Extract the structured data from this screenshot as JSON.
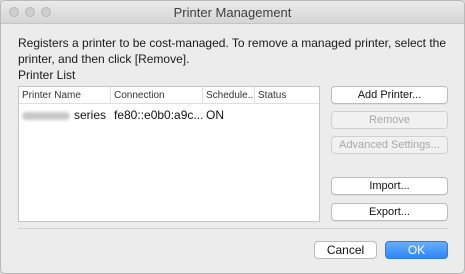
{
  "window": {
    "title": "Printer Management"
  },
  "description": "Registers a printer to be cost-managed. To remove a managed printer, select the printer, and then click [Remove].",
  "printer_list": {
    "label": "Printer List",
    "columns": [
      "Printer Name",
      "Connection",
      "Schedule...",
      "Status"
    ],
    "rows": [
      {
        "name_suffix": "series",
        "connection": "fe80::e0b0:a9c...",
        "schedule": "ON",
        "status": ""
      }
    ]
  },
  "buttons": {
    "add_printer": "Add Printer...",
    "remove": "Remove",
    "advanced_settings": "Advanced Settings...",
    "import": "Import...",
    "export": "Export...",
    "cancel": "Cancel",
    "ok": "OK"
  },
  "colors": {
    "accent": "#2f86f6",
    "window_bg": "#ececec"
  }
}
